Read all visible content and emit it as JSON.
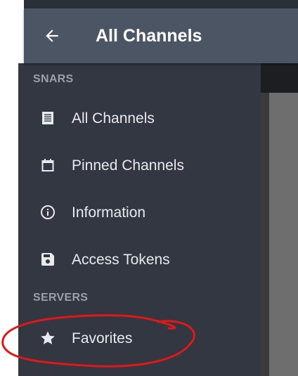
{
  "app_bar": {
    "title": "All Channels",
    "back_icon": "arrow-left-icon"
  },
  "drawer": {
    "sections": [
      {
        "header": "SNARS",
        "items": [
          {
            "label": "All Channels",
            "icon": "list-icon"
          },
          {
            "label": "Pinned Channels",
            "icon": "calendar-icon"
          },
          {
            "label": "Information",
            "icon": "info-icon"
          },
          {
            "label": "Access Tokens",
            "icon": "save-icon"
          }
        ]
      },
      {
        "header": "SERVERS",
        "items": [
          {
            "label": "Favorites",
            "icon": "star-icon"
          }
        ]
      }
    ]
  },
  "colors": {
    "app_bar": "#4c5563",
    "drawer": "#323741",
    "annotation": "#e01818"
  }
}
